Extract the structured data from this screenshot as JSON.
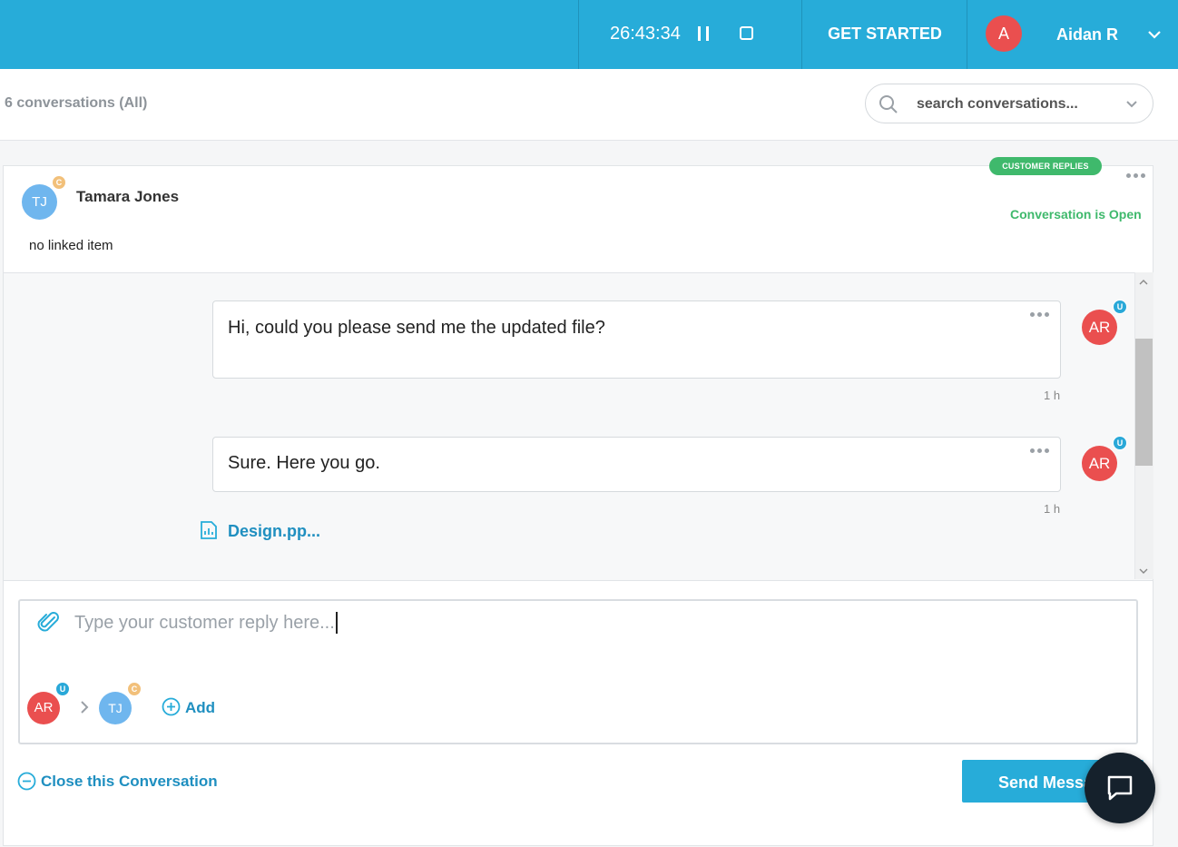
{
  "topbar": {
    "timer": "26:43:34",
    "get_started": "GET STARTED",
    "user_initial": "A",
    "user_name": "Aidan R"
  },
  "subheader": {
    "conversation_count": "6 conversations (All)",
    "search_placeholder": "search conversations..."
  },
  "conversation": {
    "customer_initials": "TJ",
    "customer_badge": "C",
    "customer_name": "Tamara Jones",
    "linked_item": "no linked item",
    "tag": "CUSTOMER REPLIES",
    "status": "Conversation is Open"
  },
  "messages": [
    {
      "text": "Hi, could you please send me the updated file?",
      "time": "1 h",
      "author_initials": "AR",
      "author_badge": "U"
    },
    {
      "text": "Sure. Here you go.",
      "time": "1 h",
      "author_initials": "AR",
      "author_badge": "U",
      "attachment": "Design.pp..."
    }
  ],
  "reply": {
    "placeholder": "Type your customer reply here...",
    "from_initials": "AR",
    "from_badge": "U",
    "to_initials": "TJ",
    "to_badge": "C",
    "add_label": "Add"
  },
  "footer": {
    "close_label": "Close this Conversation",
    "send_label": "Send Message"
  },
  "colors": {
    "brand": "#27acd9",
    "open_green": "#3fb96c",
    "agent_red": "#ea4f4f",
    "customer_blue": "#6fb6ee",
    "link_blue": "#1f8fc0"
  }
}
